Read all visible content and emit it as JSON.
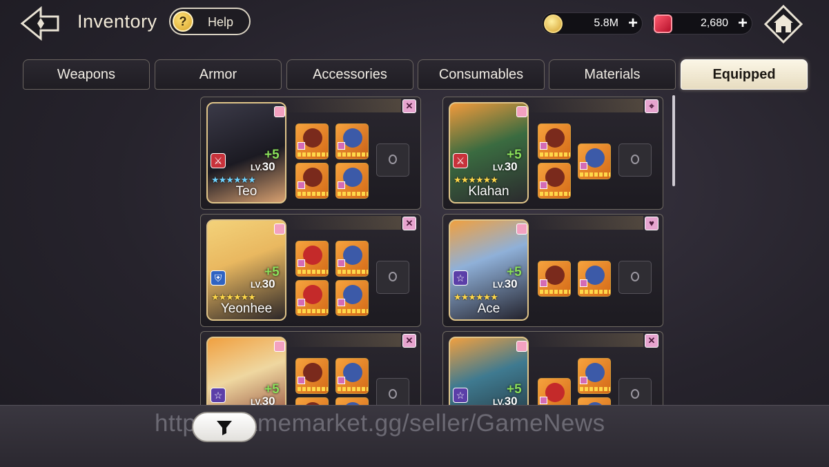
{
  "header": {
    "title": "Inventory",
    "help_label": "Help",
    "help_glyph": "?",
    "gold": {
      "value": "5.8M",
      "plus": "+"
    },
    "ruby": {
      "value": "2,680",
      "plus": "+"
    }
  },
  "tabs": [
    {
      "label": "Weapons",
      "active": false
    },
    {
      "label": "Armor",
      "active": false
    },
    {
      "label": "Accessories",
      "active": false
    },
    {
      "label": "Consumables",
      "active": false
    },
    {
      "label": "Materials",
      "active": false
    },
    {
      "label": "Equipped",
      "active": true
    }
  ],
  "characters": [
    {
      "name": "Teo",
      "plus": "+5",
      "lv_prefix": "LV.",
      "level": "30",
      "stars": "★★★★★★",
      "star_color": "blue",
      "role_icon": "sword-icon"
    },
    {
      "name": "Klahan",
      "plus": "+5",
      "lv_prefix": "LV.",
      "level": "30",
      "stars": "★★★★★★",
      "star_color": "gold",
      "role_icon": "sword-icon"
    },
    {
      "name": "Yeonhee",
      "plus": "+5",
      "lv_prefix": "LV.",
      "level": "30",
      "stars": "★★★★★★",
      "star_color": "gold",
      "role_icon": "shield-icon"
    },
    {
      "name": "Ace",
      "plus": "+5",
      "lv_prefix": "LV.",
      "level": "30",
      "stars": "★★★★★★",
      "star_color": "gold",
      "role_icon": "star-icon"
    },
    {
      "name": "",
      "plus": "+5",
      "lv_prefix": "LV.",
      "level": "30",
      "stars": "",
      "star_color": "gold",
      "role_icon": "star-icon"
    },
    {
      "name": "",
      "plus": "+5",
      "lv_prefix": "LV.",
      "level": "30",
      "stars": "",
      "star_color": "gold",
      "role_icon": "star-icon"
    }
  ],
  "watermark": "https://gamemarket.gg/seller/GameNews",
  "colors": {
    "accent": "#e7dcc0",
    "plus_green": "#8ae05a",
    "item_orange": "#f6a23d"
  }
}
